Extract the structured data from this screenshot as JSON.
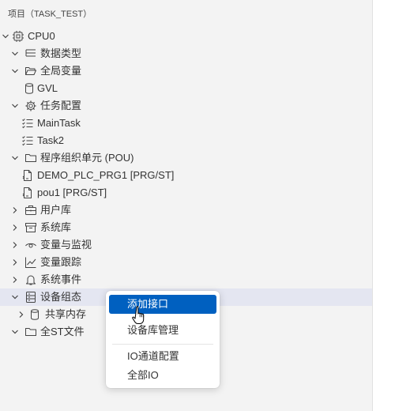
{
  "panel": {
    "title": "项目（TASK_TEST）"
  },
  "tree": {
    "root": "CPU0",
    "data_types": "数据类型",
    "global_vars": "全局变量",
    "gvl": "GVL",
    "task_config": "任务配置",
    "main_task": "MainTask",
    "task2": "Task2",
    "pou_folder": "程序组织单元 (POU)",
    "pou_demo": "DEMO_PLC_PRG1 [PRG/ST]",
    "pou_pou1": "pou1 [PRG/ST]",
    "user_lib": "用户库",
    "system_lib": "系统库",
    "var_monitor": "变量与监视",
    "var_trace": "变量跟踪",
    "system_events": "系统事件",
    "device_config": "设备组态",
    "shared_memory": "共享内存",
    "all_st_files": "全ST文件"
  },
  "context_menu": {
    "add_interface": "添加接口",
    "device_lib_mgmt": "设备库管理",
    "io_channel_config": "IO通道配置",
    "all_io": "全部IO"
  },
  "colors": {
    "panel_bg": "#f3f3f3",
    "selected_row": "#e4e6f1",
    "menu_highlight": "#0060c0"
  },
  "icons": {
    "root": "chip-icon",
    "data_types": "type-hierarchy-icon",
    "global_vars": "folder-open-icon",
    "gvl": "database-icon",
    "task_config": "gear-icon",
    "tasks": "task-list-icon",
    "pou": "folder-icon",
    "pou_item": "document-code-icon",
    "user_lib": "briefcase-icon",
    "system_lib": "archive-icon",
    "var_monitor": "eye-icon",
    "var_trace": "line-chart-icon",
    "system_events": "bell-icon",
    "device_config": "device-rack-icon",
    "shared_memory": "database-icon",
    "all_st_files": "folder-icon"
  }
}
